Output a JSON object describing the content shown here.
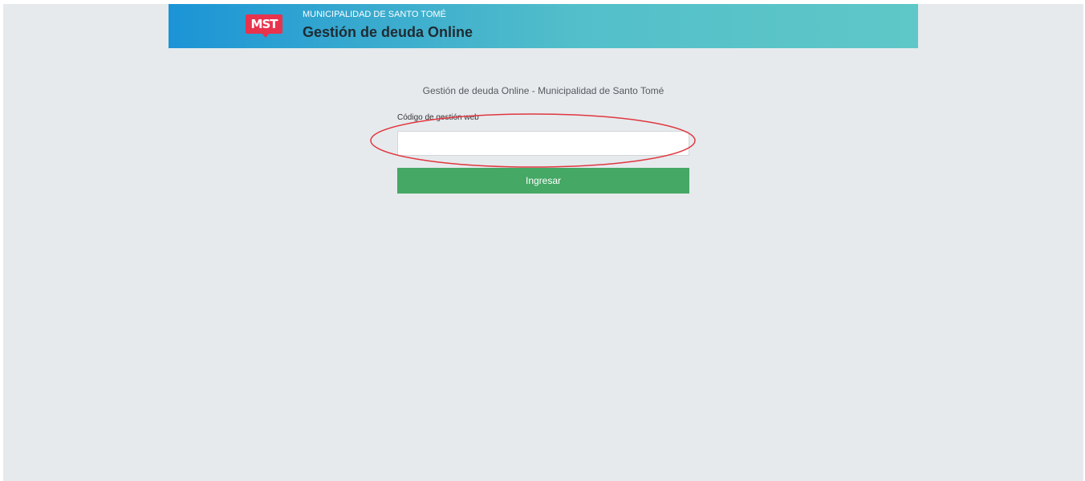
{
  "header": {
    "logo_text": "MST",
    "subtitle": "MUNICIPALIDAD DE SANTO TOMÉ",
    "title": "Gestión de deuda Online",
    "gradient_start": "#1b94d6",
    "gradient_end": "#5ec7c7",
    "logo_color": "#e8334d"
  },
  "main": {
    "intro_text": "Gestión de deuda Online - Municipalidad de Santo Tomé",
    "code_field": {
      "label": "Código de gestión web",
      "value": "",
      "placeholder": ""
    },
    "submit_label": "Ingresar",
    "submit_color": "#45a865"
  },
  "annotation": {
    "shape": "ellipse",
    "color": "#e0373f",
    "target": "code_field"
  }
}
